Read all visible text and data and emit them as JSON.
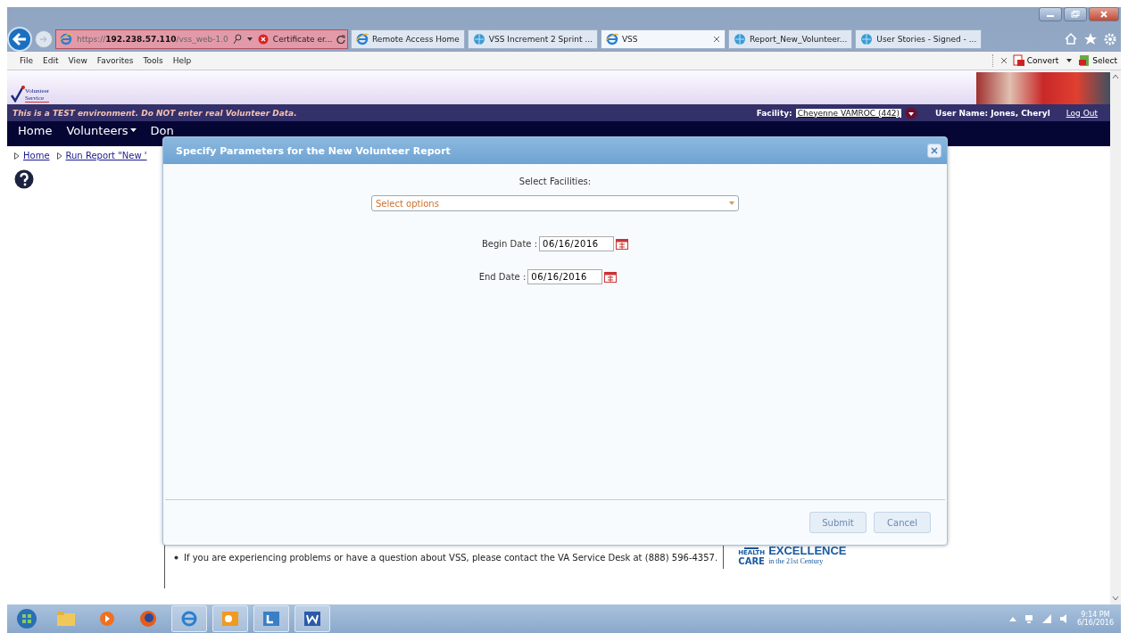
{
  "browser": {
    "address": {
      "prefix": "https://",
      "host": "192.238.57.110",
      "path": "/vss_web-1.0"
    },
    "cert": "Certificate er...",
    "tabs": [
      {
        "label": "Remote Access Home",
        "selected": false,
        "closable": false
      },
      {
        "label": "VSS Increment 2 Sprint ...",
        "selected": false,
        "closable": false
      },
      {
        "label": "VSS",
        "selected": true,
        "closable": true
      },
      {
        "label": "Report_New_Volunteer...",
        "selected": false,
        "closable": false
      },
      {
        "label": "User Stories - Signed - ...",
        "selected": false,
        "closable": false
      }
    ],
    "menu": [
      "File",
      "Edit",
      "View",
      "Favorites",
      "Tools",
      "Help"
    ],
    "toolbar": [
      {
        "label": "Convert",
        "dropdown": true
      },
      {
        "label": "Select",
        "dropdown": false
      }
    ]
  },
  "site": {
    "logo": [
      "Volunteer",
      "Service"
    ],
    "test_notice": "This is a TEST environment. Do NOT enter real Volunteer Data.",
    "facility_label": "Facility:",
    "facility": "Cheyenne VAMROC (442)",
    "user_label": "User Name:",
    "user": "Jones, Cheryl",
    "logout": "Log Out",
    "nav": [
      {
        "label": "Home",
        "dropdown": false
      },
      {
        "label": "Volunteers",
        "dropdown": true
      },
      {
        "label": "Don",
        "dropdown": false
      }
    ],
    "breadcrumb": [
      "Home",
      "Run Report \"New '"
    ],
    "notice": "If you are experiencing problems or have a question about VSS, please contact the VA Service Desk at (888) 596-4357.",
    "badge": {
      "top": "HEALTH",
      "bottom": "CARE",
      "title": "EXCELLENCE",
      "sub": "in the 21st Century"
    }
  },
  "dialog": {
    "title": "Specify Parameters for the New Volunteer Report",
    "facilities_label": "Select Facilities:",
    "facilities_placeholder": "Select options",
    "begin_label": "Begin Date :",
    "begin": "06/16/2016",
    "end_label": "End Date :",
    "end": "06/16/2016",
    "buttons": [
      "Submit",
      "Cancel"
    ]
  },
  "taskbar": {
    "time": "9:14 PM",
    "date": "6/16/2016"
  }
}
